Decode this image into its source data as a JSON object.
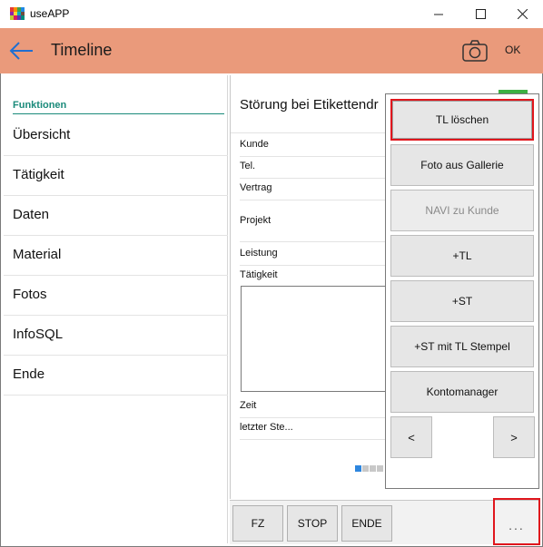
{
  "window": {
    "title": "useAPP",
    "minimize": "—",
    "maximize": "☐",
    "close": "✕"
  },
  "appbar": {
    "title": "Timeline",
    "ok_label": "OK"
  },
  "sidebar": {
    "heading": "Funktionen",
    "items": [
      "Übersicht",
      "Tätigkeit",
      "Daten",
      "Material",
      "Fotos",
      "InfoSQL",
      "Ende"
    ]
  },
  "main": {
    "title": "Störung bei Etikettendr",
    "fields": {
      "kunde": "Kunde",
      "tel": "Tel.",
      "vertrag": "Vertrag",
      "projekt": "Projekt",
      "leistung": "Leistung",
      "taetigkeit": "Tätigkeit",
      "zeit": "Zeit",
      "letzter": "letzter Ste..."
    }
  },
  "bottombar": {
    "fz": "FZ",
    "stop": "STOP",
    "ende": "ENDE",
    "more": "..."
  },
  "flyout": {
    "tl_loeschen": "TL löschen",
    "foto_gallerie": "Foto aus Gallerie",
    "navi_kunde": "NAVI zu Kunde",
    "plus_tl": "+TL",
    "plus_st": "+ST",
    "st_tl_stempel": "+ST mit TL Stempel",
    "kontomanager": "Kontomanager",
    "prev": "<",
    "next": ">"
  },
  "colors": {
    "appbar": "#ea9a7b",
    "accent": "#1a8a7a",
    "highlight": "#e0161d",
    "back_arrow": "#1f6fd1"
  }
}
